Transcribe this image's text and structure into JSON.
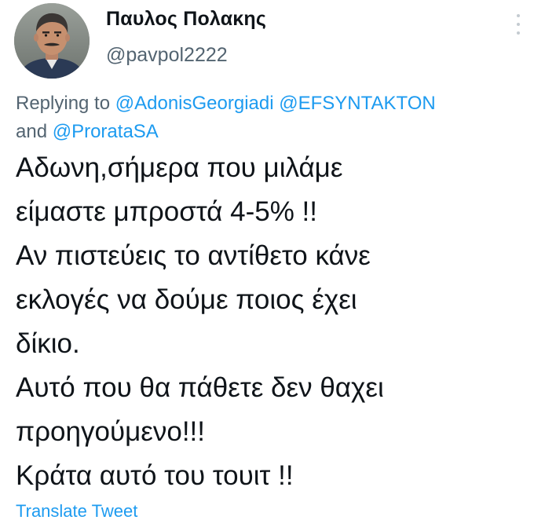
{
  "tweet": {
    "author": {
      "display_name": "Παυλος Πολακης",
      "handle": "@pavpol2222",
      "avatar_icon": "avatar-photo"
    },
    "more_icon": "vertical-ellipsis-icon",
    "reply": {
      "prefix": "Replying to",
      "mentions": [
        "@AdonisGeorgiadi",
        "@EFSYNTAKTON",
        "@ProrataSA"
      ],
      "conjunction": "and"
    },
    "text_lines": [
      "Αδωνη,σήμερα που μιλάμε",
      "είμαστε μπροστά 4-5% !!",
      "Αν πιστεύεις το αντίθετο κάνε",
      "εκλογές να δούμε ποιος έχει",
      "δίκιο.",
      "Αυτό που θα πάθετε δεν θαχει",
      "προηγούμενο!!!",
      "Κράτα αυτό του τουιτ !!"
    ],
    "translate_label": "Translate Tweet"
  },
  "colors": {
    "text_primary": "#0f1419",
    "text_secondary": "#536471",
    "link": "#1d9bf0",
    "background": "#ffffff"
  }
}
